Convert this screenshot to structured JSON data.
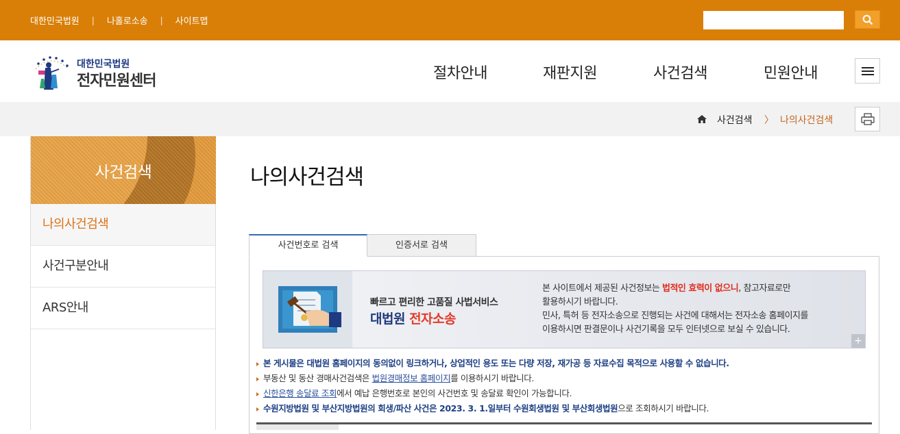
{
  "topbar": {
    "links": [
      "대한민국법원",
      "나홀로소송",
      "사이트맵"
    ],
    "separator": "|",
    "search_placeholder": ""
  },
  "header": {
    "logo_sub": "대한민국법원",
    "logo_main": "전자민원센터",
    "gnb": [
      "절차안내",
      "재판지원",
      "사건검색",
      "민원안내"
    ]
  },
  "location": {
    "crumbs": [
      "사건검색",
      "나의사건검색"
    ],
    "arrow": "〉"
  },
  "lnb": {
    "title": "사건검색",
    "items": [
      "나의사건검색",
      "사건구분안내",
      "ARS안내"
    ]
  },
  "main": {
    "title": "나의사건검색",
    "tabs": [
      "사건번호로 검색",
      "인증서로 검색"
    ],
    "banner": {
      "headline": "빠르고 편리한 고품질 사법서비스",
      "brand_a": "대법원 ",
      "brand_b": "전자소송",
      "line1_a": "본 사이트에서 제공된 사건정보는 ",
      "line1_warn": "법적인 효력이 없으니",
      "line1_b": ", 참고자료로만",
      "line2": "활용하시기 바랍니다.",
      "line3": "민사, 특허 등 전자소송으로 진행되는 사건에 대해서는 전자소송 홈페이지를",
      "line4": "이용하시면 판결문이나 사건기록을 모두 인터넷으로 보실 수 있습니다.",
      "more": "+"
    },
    "notices": {
      "n1": "본 게시물은 대법원 홈페이지의 동의없이 링크하거나, 상업적인 용도 또는 다량 저장, 재가공 등 자료수집 목적으로 사용할 수 없습니다.",
      "n2_a": "부동산 및 동산 경매사건검색은 ",
      "n2_link": "법원경매정보 홈페이지",
      "n2_b": "를 이용하시기 바랍니다.",
      "n3_link": "신한은행 송달료 조회",
      "n3_b": "에서 예납 은행번호로 본인의 사건번호 및 송달료 확인이 가능합니다.",
      "n4_bold": "수원지방법원 및 부산지방법원의 회생/파산 사건은 2023. 3. 1.일부터 수원회생법원 및 부산회생법원",
      "n4_rest": "으로 조회하시기 바랍니다."
    }
  },
  "colors": {
    "topbar": "#d97f08",
    "accent": "#d8741a",
    "brand_blue": "#1d3a82",
    "warn_red": "#e02b1c"
  },
  "icons": {
    "search": "search-icon",
    "hamburger": "menu-icon",
    "home": "home-icon",
    "print": "print-icon"
  }
}
